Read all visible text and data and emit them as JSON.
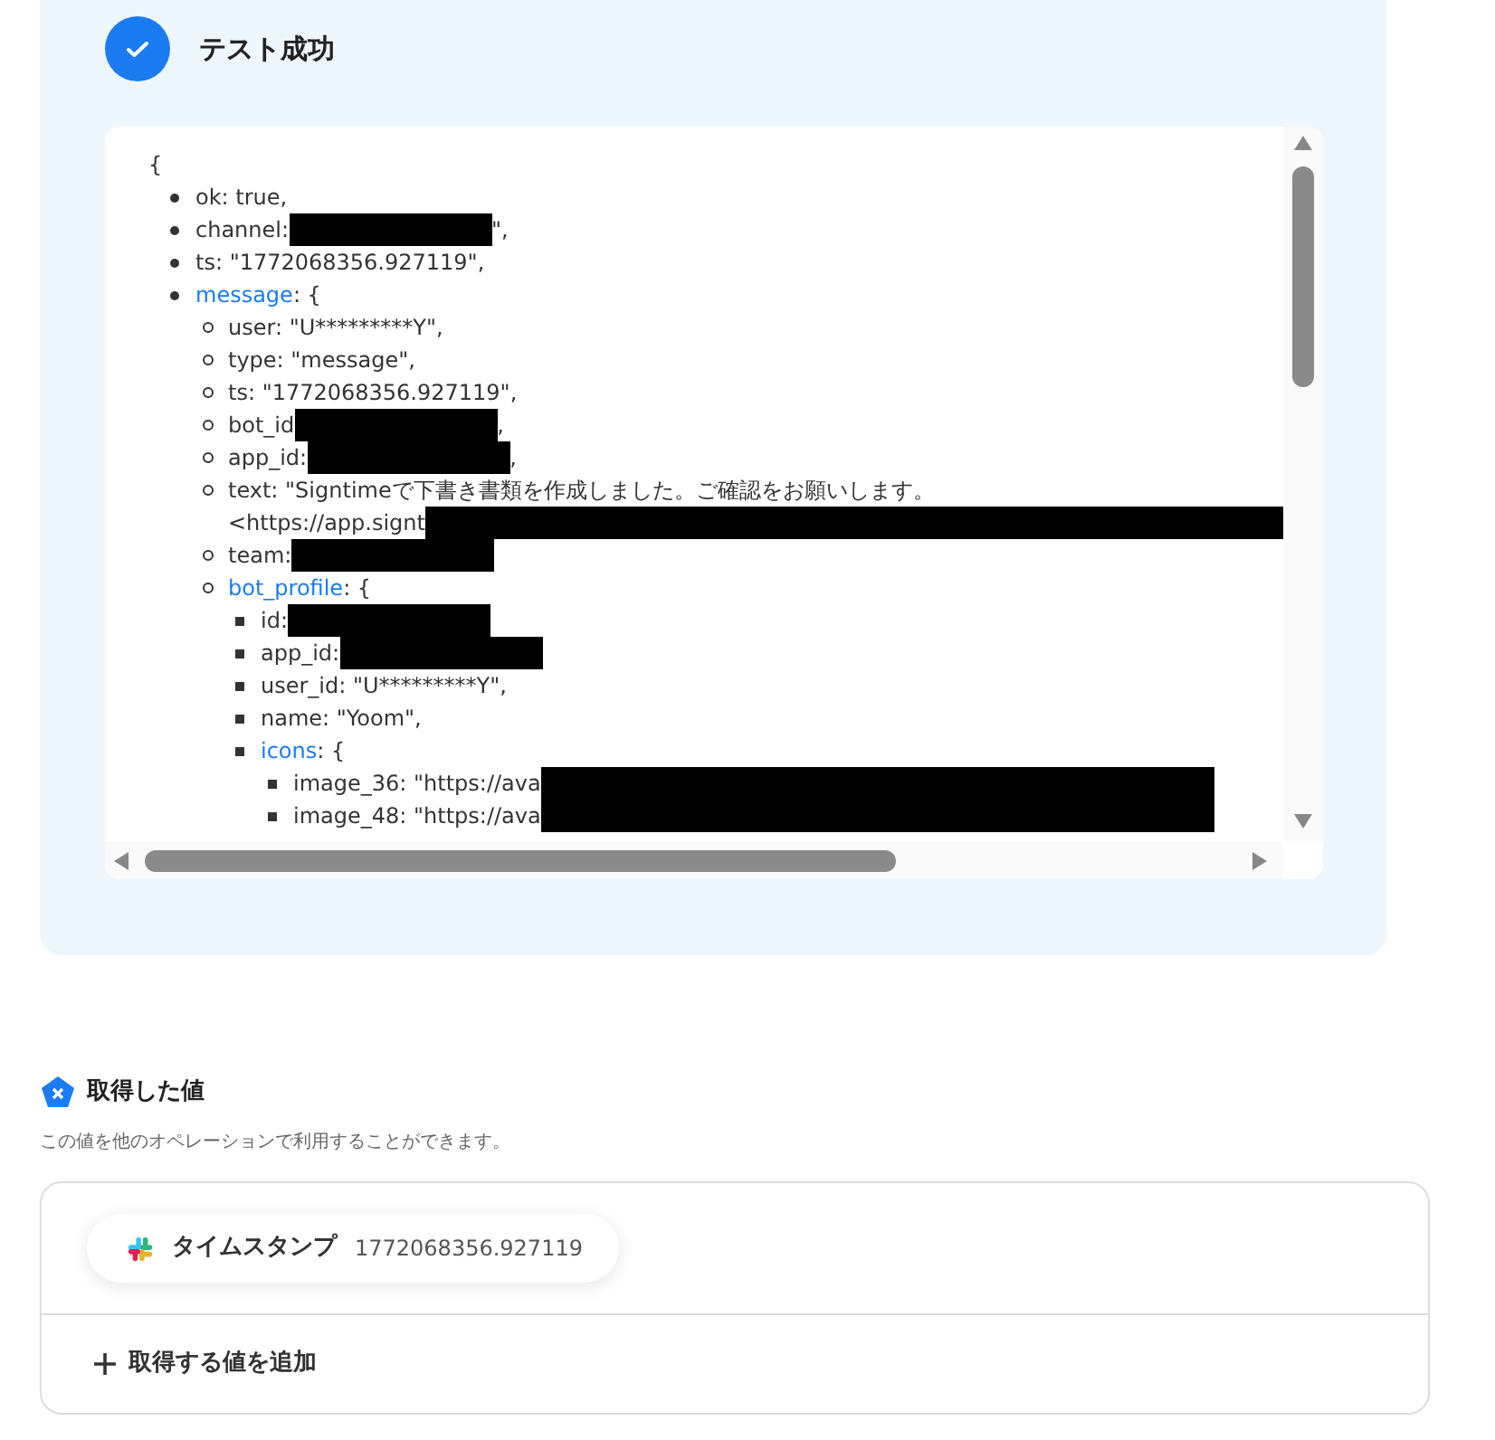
{
  "result": {
    "title": "テスト成功",
    "open_brace": "{",
    "lines": [
      {
        "text": "ok: true,"
      },
      {
        "text": "channel:",
        "redacted": true,
        "kind": "short",
        "after": "\","
      },
      {
        "text": "ts: \"1772068356.927119\","
      },
      {
        "key": "message",
        "text": ": {",
        "children": [
          {
            "text": "user: \"U*********Y\","
          },
          {
            "text": "type: \"message\","
          },
          {
            "text": "ts: \"1772068356.927119\","
          },
          {
            "text": "bot_id",
            "redacted": true,
            "kind": "short",
            "after": ","
          },
          {
            "text": "app_id:",
            "redacted": true,
            "kind": "short",
            "after": ","
          },
          {
            "text": "text: \"Signtimeで下書き書類を作成しました。ご確認をお願いします。",
            "continuation": "<https://app.signt",
            "redacted": true,
            "kind": "long"
          },
          {
            "text": "team:",
            "redacted": true,
            "kind": "short"
          },
          {
            "key": "bot_profile",
            "text": ": {",
            "children": [
              {
                "text": "id:",
                "redacted": true,
                "kind": "short"
              },
              {
                "text": "app_id:",
                "redacted": true,
                "kind": "short"
              },
              {
                "text": "user_id: \"U*********Y\","
              },
              {
                "text": "name: \"Yoom\","
              },
              {
                "key": "icons",
                "text": ": {",
                "children": [
                  {
                    "text": "image_36: \"https://ava",
                    "redacted": true,
                    "kind": "medium"
                  },
                  {
                    "text": "image_48: \"https://ava",
                    "redacted": true,
                    "kind": "medium"
                  }
                ]
              }
            ]
          }
        ]
      }
    ]
  },
  "values": {
    "title": "取得した値",
    "description": "この値を他のオペレーションで利用することができます。",
    "items": [
      {
        "label": "タイムスタンプ",
        "value": "1772068356.927119"
      }
    ],
    "add_button": "取得する値を追加"
  }
}
